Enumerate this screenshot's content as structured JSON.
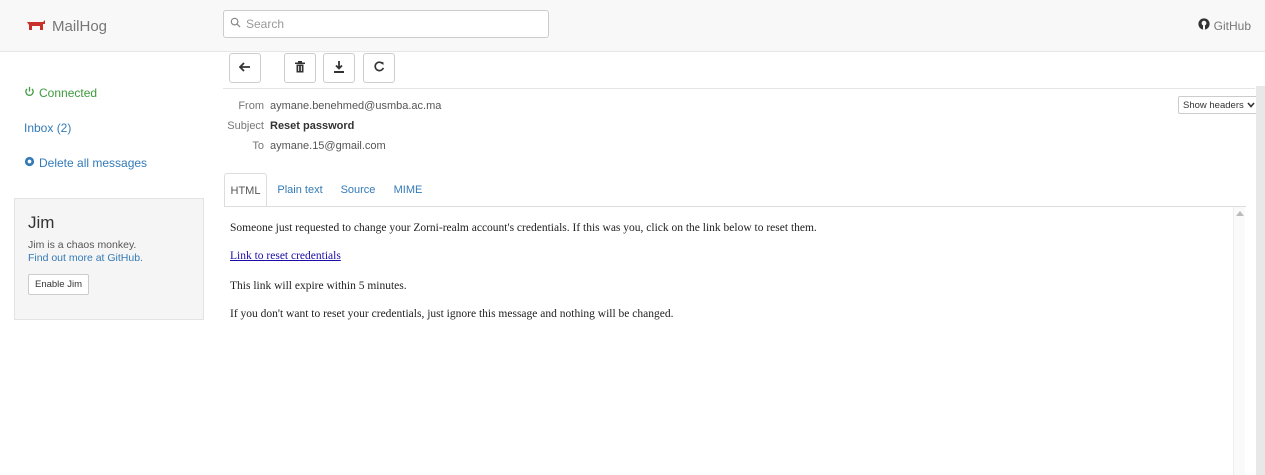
{
  "navbar": {
    "brand": "MailHog",
    "search_placeholder": "Search",
    "github_label": "GitHub"
  },
  "sidebar": {
    "status": "Connected",
    "inbox": "Inbox (2)",
    "delete_all": "Delete all messages"
  },
  "jim": {
    "title": "Jim",
    "description": "Jim is a chaos monkey.",
    "link_text": "Find out more at GitHub.",
    "button": "Enable Jim"
  },
  "toolbar": {
    "icons": [
      "back-arrow-icon",
      "trash-icon",
      "download-icon",
      "release-icon"
    ]
  },
  "message": {
    "labels": {
      "from": "From",
      "subject": "Subject",
      "to": "To"
    },
    "from": "aymane.benehmed@usmba.ac.ma",
    "subject": "Reset password",
    "to": "aymane.15@gmail.com",
    "show_headers": "Show headers"
  },
  "tabs": [
    "HTML",
    "Plain text",
    "Source",
    "MIME"
  ],
  "active_tab": "HTML",
  "email_body": {
    "line1": "Someone just requested to change your Zorni-realm account's credentials. If this was you, click on the link below to reset them.",
    "link": "Link to reset credentials",
    "line2": "This link will expire within 5 minutes.",
    "line3": "If you don't want to reset your credentials, just ignore this message and nothing will be changed."
  },
  "colors": {
    "brand_red": "#c9302c",
    "link_blue": "#337ab7",
    "connected_green": "#3c9a3c"
  }
}
